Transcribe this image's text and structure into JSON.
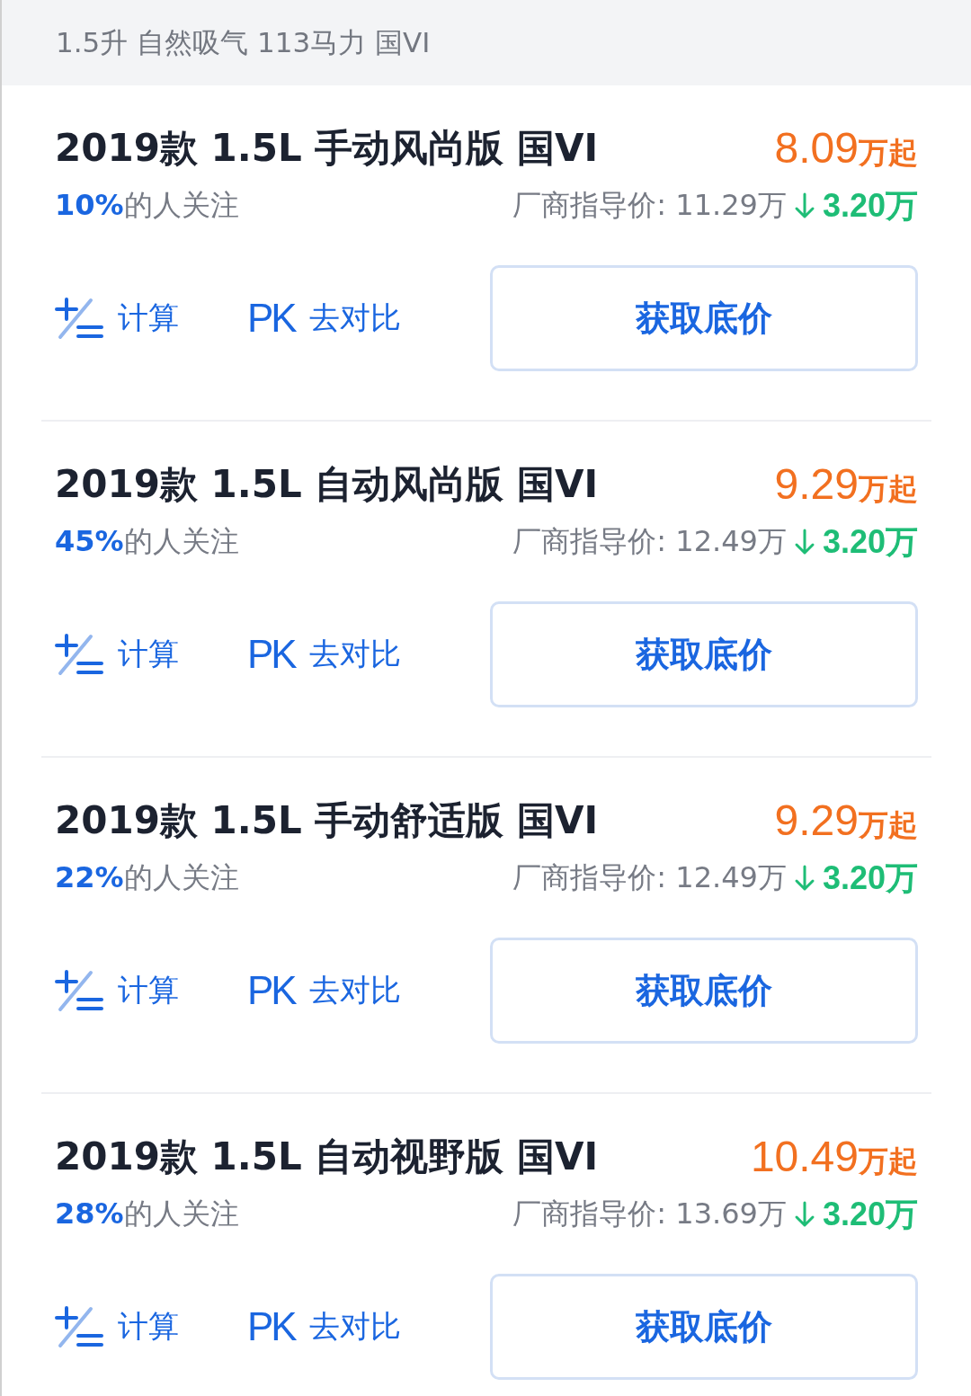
{
  "header": {
    "spec": "1.5升 自然吸气 113马力 国VI"
  },
  "trims": [
    {
      "name": "2019款 1.5L 手动风尚版 国VI",
      "price": "8.09",
      "price_unit": "万起",
      "attention": "**10%**的人关注",
      "guide_price": "厂商指导价: 11.29万",
      "drop": "3.20万",
      "calc": "计算",
      "pk_mark": "PK",
      "compare": "去对比",
      "cta": "获取底价"
    },
    {
      "name": "2019款 1.5L 自动风尚版 国VI",
      "price": "9.29",
      "price_unit": "万起",
      "attention": "**45%**的人关注",
      "guide_price": "厂商指导价: 12.49万",
      "drop": "3.20万",
      "calc": "计算",
      "pk_mark": "PK",
      "compare": "去对比",
      "cta": "获取底价"
    },
    {
      "name": "2019款 1.5L 手动舒适版 国VI",
      "price": "9.29",
      "price_unit": "万起",
      "attention": "**22%**的人关注",
      "guide_price": "厂商指导价: 12.49万",
      "drop": "3.20万",
      "calc": "计算",
      "pk_mark": "PK",
      "compare": "去对比",
      "cta": "获取底价"
    },
    {
      "name": "2019款 1.5L 自动视野版 国VI",
      "price": "10.49",
      "price_unit": "万起",
      "attention": "**28%**的人关注",
      "guide_price": "厂商指导价: 13.69万",
      "drop": "3.20万",
      "calc": "计算",
      "pk_mark": "PK",
      "compare": "去对比",
      "cta": "获取底价"
    }
  ]
}
